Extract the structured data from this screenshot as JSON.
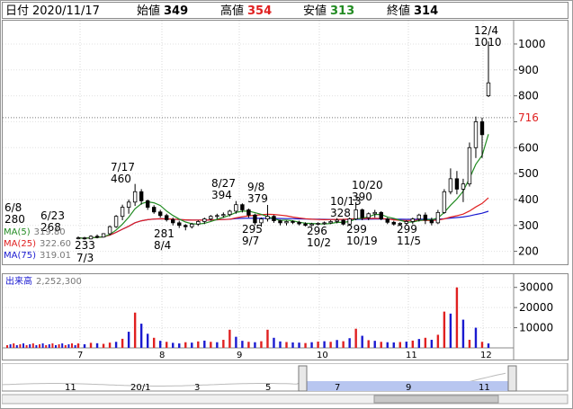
{
  "header": {
    "date_label": "日付",
    "date_value": "2020/11/17",
    "open_label": "始値",
    "open_value": "349",
    "high_label": "高値",
    "high_value": "354",
    "low_label": "安値",
    "low_value": "313",
    "close_label": "終値",
    "close_value": "314"
  },
  "colors": {
    "up": "#ffffff",
    "down": "#000000",
    "ma5": "#228b22",
    "ma25": "#e02020",
    "ma75": "#1a1ad0",
    "vol_up": "#e02020",
    "vol_down": "#1a1ad0",
    "high": "#e02020",
    "low": "#228b22"
  },
  "legend": {
    "ma5_label": "MA(5)",
    "ma5_value": "319.80",
    "ma25_label": "MA(25)",
    "ma25_value": "322.60",
    "ma75_label": "MA(75)",
    "ma75_value": "319.01"
  },
  "volume_legend": {
    "label": "出来高",
    "value": "2,252,300"
  },
  "chart_data": [
    {
      "type": "candlestick",
      "x_axis_labels": [
        "7",
        "8",
        "9",
        "10",
        "11",
        "12"
      ],
      "y_ticks": [
        200,
        300,
        400,
        500,
        600,
        700,
        800,
        900,
        1000
      ],
      "ylim": [
        150,
        1090
      ],
      "current_price": "716",
      "grid": true,
      "annotations": [
        {
          "date": "6/8",
          "value": "280"
        },
        {
          "date": "6/23",
          "value": "268"
        },
        {
          "date": "7/3",
          "value": "233"
        },
        {
          "date": "7/17",
          "value": "460"
        },
        {
          "date": "8/4",
          "value": "281"
        },
        {
          "date": "8/27",
          "value": "394"
        },
        {
          "date": "9/8",
          "value": "379"
        },
        {
          "date": "9/7",
          "value": "295"
        },
        {
          "date": "10/2",
          "value": "296"
        },
        {
          "date": "10/13",
          "value": "328"
        },
        {
          "date": "10/20",
          "value": "390"
        },
        {
          "date": "10/19",
          "value": "299"
        },
        {
          "date": "11/5",
          "value": "299"
        },
        {
          "date": "12/4",
          "value": "1010"
        }
      ],
      "ohlc": [
        [
          250,
          258,
          246,
          252
        ],
        [
          252,
          256,
          245,
          248
        ],
        [
          248,
          262,
          246,
          258
        ],
        [
          258,
          265,
          250,
          255
        ],
        [
          255,
          270,
          253,
          268
        ],
        [
          268,
          300,
          262,
          295
        ],
        [
          295,
          340,
          290,
          335
        ],
        [
          335,
          380,
          320,
          370
        ],
        [
          370,
          400,
          345,
          390
        ],
        [
          390,
          460,
          375,
          430
        ],
        [
          430,
          440,
          380,
          395
        ],
        [
          395,
          400,
          360,
          370
        ],
        [
          370,
          378,
          345,
          352
        ],
        [
          352,
          360,
          330,
          338
        ],
        [
          338,
          345,
          315,
          322
        ],
        [
          322,
          330,
          300,
          310
        ],
        [
          310,
          318,
          290,
          300
        ],
        [
          300,
          305,
          281,
          295
        ],
        [
          295,
          310,
          288,
          305
        ],
        [
          305,
          320,
          298,
          315
        ],
        [
          315,
          330,
          305,
          325
        ],
        [
          325,
          340,
          318,
          335
        ],
        [
          335,
          345,
          325,
          338
        ],
        [
          338,
          350,
          330,
          342
        ],
        [
          342,
          360,
          335,
          355
        ],
        [
          355,
          394,
          345,
          380
        ],
        [
          380,
          385,
          350,
          360
        ],
        [
          360,
          365,
          330,
          340
        ],
        [
          340,
          345,
          300,
          310
        ],
        [
          310,
          330,
          295,
          325
        ],
        [
          325,
          379,
          315,
          335
        ],
        [
          335,
          340,
          310,
          318
        ],
        [
          318,
          322,
          300,
          310
        ],
        [
          310,
          318,
          300,
          315
        ],
        [
          315,
          320,
          305,
          312
        ],
        [
          312,
          318,
          300,
          306
        ],
        [
          306,
          312,
          296,
          300
        ],
        [
          300,
          310,
          296,
          305
        ],
        [
          305,
          312,
          300,
          308
        ],
        [
          308,
          315,
          302,
          310
        ],
        [
          310,
          320,
          305,
          315
        ],
        [
          315,
          328,
          308,
          320
        ],
        [
          320,
          325,
          300,
          305
        ],
        [
          305,
          330,
          299,
          325
        ],
        [
          325,
          390,
          320,
          360
        ],
        [
          360,
          365,
          320,
          330
        ],
        [
          330,
          350,
          320,
          345
        ],
        [
          345,
          360,
          330,
          350
        ],
        [
          350,
          355,
          320,
          325
        ],
        [
          325,
          330,
          305,
          312
        ],
        [
          312,
          318,
          299,
          305
        ],
        [
          305,
          312,
          298,
          308
        ],
        [
          308,
          320,
          302,
          315
        ],
        [
          315,
          330,
          305,
          325
        ],
        [
          325,
          345,
          315,
          340
        ],
        [
          340,
          350,
          305,
          320
        ],
        [
          320,
          330,
          300,
          310
        ],
        [
          310,
          360,
          305,
          350
        ],
        [
          350,
          440,
          345,
          430
        ],
        [
          430,
          520,
          420,
          480
        ],
        [
          480,
          510,
          420,
          440
        ],
        [
          440,
          480,
          390,
          460
        ],
        [
          460,
          620,
          450,
          600
        ],
        [
          600,
          720,
          560,
          700
        ],
        [
          700,
          716,
          560,
          650
        ],
        [
          800,
          1010,
          795,
          850
        ]
      ],
      "volume": {
        "y_ticks": [
          10000,
          20000,
          30000
        ],
        "ylim": [
          0,
          33000
        ],
        "values": [
          2200,
          1800,
          2500,
          2300,
          2000,
          2600,
          3000,
          4500,
          8000,
          17500,
          12000,
          7000,
          5000,
          3500,
          3000,
          2500,
          2200,
          2800,
          2600,
          3200,
          3600,
          3000,
          2800,
          4000,
          9000,
          5500,
          3500,
          3000,
          2800,
          3300,
          9000,
          5000,
          3200,
          2900,
          2700,
          2600,
          2400,
          2800,
          3100,
          3300,
          3000,
          3900,
          3300,
          4800,
          9500,
          6000,
          3800,
          3500,
          3000,
          2800,
          2700,
          2900,
          3100,
          3600,
          4400,
          5000,
          4000,
          6500,
          18000,
          17000,
          30000,
          14000,
          4000,
          10000,
          3000,
          2200
        ],
        "colors": [
          "u",
          "d",
          "u",
          "d",
          "u",
          "u",
          "d",
          "u",
          "d",
          "u",
          "d",
          "d",
          "u",
          "d",
          "u",
          "d",
          "d",
          "u",
          "d",
          "u",
          "d",
          "u",
          "d",
          "u",
          "u",
          "d",
          "d",
          "u",
          "d",
          "u",
          "u",
          "d",
          "d",
          "u",
          "d",
          "d",
          "u",
          "d",
          "u",
          "d",
          "u",
          "d",
          "u",
          "d",
          "u",
          "d",
          "u",
          "d",
          "u",
          "d",
          "d",
          "u",
          "d",
          "u",
          "d",
          "u",
          "d",
          "u",
          "u",
          "d",
          "u",
          "d",
          "u",
          "d",
          "u",
          "d"
        ]
      },
      "volume_x_axis_labels": [
        "7",
        "8",
        "9",
        "10",
        "11",
        "12"
      ]
    }
  ],
  "navigator": {
    "labels": [
      "11",
      "20/1",
      "3",
      "5",
      "7",
      "9",
      "11"
    ]
  }
}
